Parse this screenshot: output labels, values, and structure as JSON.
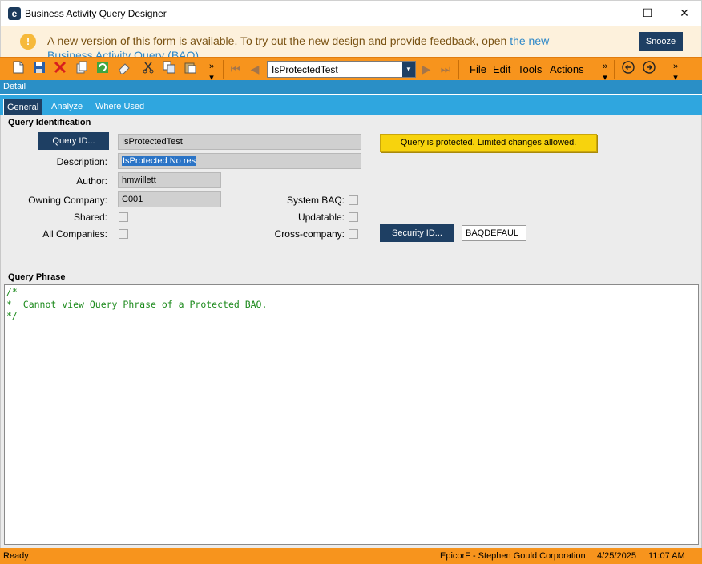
{
  "window": {
    "title": "Business Activity Query Designer",
    "icon_letter": "e",
    "minimize": "—",
    "maximize": "☐",
    "close": "✕"
  },
  "banner": {
    "text": "A new version of this form is available. To try out the new design and provide feedback, open ",
    "link_text": "the new Business Activity Query (BAQ)",
    "snooze_label": "Snooze",
    "icon": "!"
  },
  "toolbar": {
    "combo_value": "IsProtectedTest",
    "menus": [
      "File",
      "Edit",
      "Tools",
      "Actions"
    ]
  },
  "detail_label": "Detail",
  "tabs": [
    {
      "label": "General",
      "active": true
    },
    {
      "label": "Analyze",
      "active": false
    },
    {
      "label": "Where Used",
      "active": false
    }
  ],
  "query_identification": {
    "section_title": "Query Identification",
    "query_id_button": "Query ID...",
    "query_id_value": "IsProtectedTest",
    "description_label": "Description:",
    "description_value": "IsProtected   No res",
    "author_label": "Author:",
    "author_value": "hmwillett",
    "owning_company_label": "Owning Company:",
    "owning_company_value": "C001",
    "shared_label": "Shared:",
    "all_companies_label": "All Companies:",
    "system_baq_label": "System BAQ:",
    "updatable_label": "Updatable:",
    "cross_company_label": "Cross-company:",
    "security_id_button": "Security ID...",
    "security_id_value": "BAQDEFAUL",
    "protected_message": "Query is protected. Limited changes allowed."
  },
  "query_phrase": {
    "section_title": "Query Phrase",
    "lines": [
      "/*",
      "*  Cannot view Query Phrase of a Protected BAQ.",
      "*/"
    ]
  },
  "status": {
    "left": "Ready",
    "company": "EpicorF - Stephen Gould Corporation",
    "date": "4/25/2025",
    "time": "11:07 AM"
  },
  "colors": {
    "accent_orange": "#f7941d",
    "navy": "#1e3f63",
    "tab_blue": "#2fa6df",
    "alert_yellow": "#f7d30d"
  }
}
